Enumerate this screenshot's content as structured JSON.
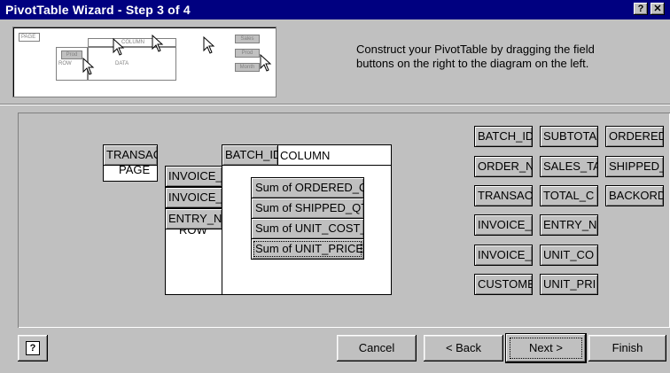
{
  "window": {
    "title": "PivotTable Wizard - Step 3 of 4",
    "help_label": "?",
    "close_label": "✕"
  },
  "instructions": "Construct your PivotTable by dragging the field buttons on the right to the diagram on the left.",
  "preview": {
    "page": "PAGE",
    "column": "COLUMN",
    "row": "ROW",
    "data": "DATA",
    "buttons": [
      "Sales",
      "Prod",
      "Month"
    ],
    "dragged": "Prod"
  },
  "layout": {
    "page_label": "PAGE",
    "row_label": "ROW",
    "column_label": "COLUMN",
    "page_fields": [
      "TRANSAC"
    ],
    "row_fields": [
      "INVOICE_",
      "INVOICE_",
      "ENTRY_NI"
    ],
    "column_fields": [
      "BATCH_ID"
    ],
    "data_fields": [
      "Sum of ORDERED_Q",
      "Sum of SHIPPED_QT",
      "Sum of UNIT_COST_",
      "Sum of UNIT_PRICE"
    ]
  },
  "field_buttons": {
    "col1": [
      "BATCH_ID",
      "ORDER_N",
      "TRANSAC",
      "INVOICE_",
      "INVOICE_",
      "CUSTOME"
    ],
    "col2": [
      "SUBTOTA",
      "SALES_TA",
      "TOTAL_C",
      "ENTRY_NI",
      "UNIT_CO",
      "UNIT_PRI"
    ],
    "col3": [
      "ORDERED",
      "SHIPPED_",
      "BACKORD"
    ]
  },
  "footer": {
    "help_icon": "?",
    "cancel": "Cancel",
    "back": "< Back",
    "next": "Next >",
    "finish": "Finish"
  }
}
